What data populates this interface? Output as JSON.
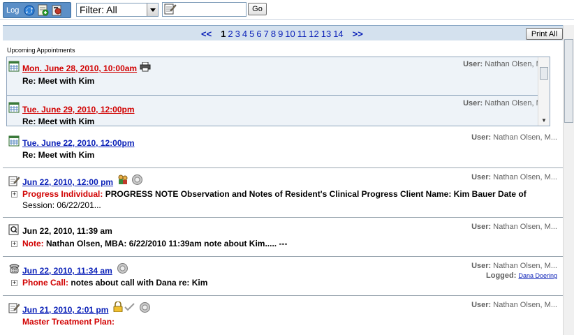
{
  "toolbar": {
    "log_label": "Log",
    "filter": {
      "value": "Filter: All"
    },
    "search": {
      "value": ""
    },
    "go_label": "Go"
  },
  "pager": {
    "prev": "<<",
    "next": ">>",
    "pages": [
      "1",
      "2",
      "3",
      "4",
      "5",
      "6",
      "7",
      "8",
      "9",
      "10",
      "11",
      "12",
      "13",
      "14"
    ],
    "current": "1",
    "print_all": "Print All"
  },
  "upcoming": {
    "title": "Upcoming Appointments",
    "items": [
      {
        "date": "Mon. June 28, 2010, 10:00am",
        "re": "Re: Meet with Kim",
        "user_label": "User:",
        "user": "Nathan Olsen, M..."
      },
      {
        "date": "Tue. June 29, 2010, 12:00pm",
        "re": "Re: Meet with Kim",
        "user_label": "User:",
        "user": "Nathan Olsen, M..."
      }
    ]
  },
  "entries": [
    {
      "date": "Tue. June 22, 2010, 12:00pm",
      "re": "Re: Meet with Kim",
      "user_label": "User:",
      "user": "Nathan Olsen, M..."
    },
    {
      "date": "Jun 22, 2010, 12:00 pm",
      "type": "Progress Individual:",
      "body": "PROGRESS NOTE Observation and Notes of Resident's Clinical Progress Client Name: Kim Bauer Date of",
      "body_cont": "Session: 06/22/201...",
      "user_label": "User:",
      "user": "Nathan Olsen, M..."
    },
    {
      "date": "Jun 22, 2010, 11:39 am",
      "type": "Note:",
      "body": "Nathan Olsen, MBA: 6/22/2010 11:39am note about Kim..... ---",
      "user_label": "User:",
      "user": "Nathan Olsen, M..."
    },
    {
      "date": "Jun 22, 2010, 11:34 am",
      "type": "Phone Call:",
      "body": "notes about call with Dana re: Kim",
      "user_label": "User:",
      "user": "Nathan Olsen, M...",
      "logged_label": "Logged:",
      "logged_by": "Dana Doering"
    },
    {
      "date": "Jun 21, 2010, 2:01 pm",
      "type": "Master Treatment Plan:",
      "user_label": "User:",
      "user": "Nathan Olsen, M..."
    }
  ],
  "colors": {
    "link_blue": "#0b21b8",
    "alert_red": "#d10000",
    "header_band": "#d4e1ee",
    "log_group": "#5b8fc7"
  },
  "icons": {
    "toolbar": [
      "refresh-icon",
      "add-note-icon",
      "tools-icon"
    ],
    "rows": [
      "calendar-icon",
      "notepad-icon",
      "q-note-icon",
      "phone-icon",
      "printer-icon",
      "group-icon",
      "disc-icon",
      "lock-icon",
      "checkmark-icon"
    ]
  }
}
